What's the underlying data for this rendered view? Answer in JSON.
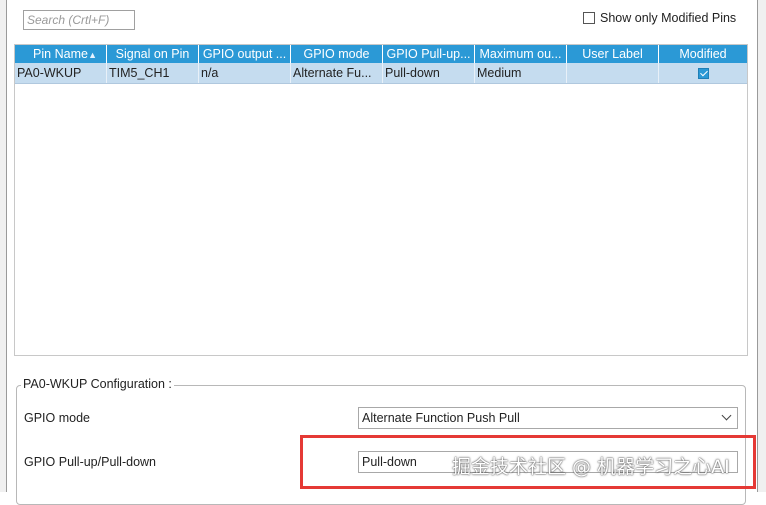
{
  "search": {
    "placeholder": "Search (Crtl+F)"
  },
  "filter": {
    "show_modified_label": "Show only Modified Pins"
  },
  "table": {
    "columns": [
      "Pin Name",
      "Signal on Pin",
      "GPIO output ...",
      "GPIO mode",
      "GPIO Pull-up...",
      "Maximum ou...",
      "User Label",
      "Modified"
    ],
    "rows": [
      {
        "pin_name": "PA0-WKUP",
        "signal": "TIM5_CH1",
        "gpio_output": "n/a",
        "gpio_mode": "Alternate Fu...",
        "pull": "Pull-down",
        "max_output": "Medium",
        "user_label": "",
        "modified": true
      }
    ]
  },
  "config": {
    "title": "PA0-WKUP Configuration :",
    "gpio_mode_label": "GPIO mode",
    "gpio_mode_value": "Alternate Function Push Pull",
    "pull_label": "GPIO Pull-up/Pull-down",
    "pull_value": "Pull-down"
  },
  "watermark": "掘金技术社区 @ 机器学习之心AI",
  "colors": {
    "header_blue": "#2b99d6",
    "selected_row": "#c5dcef",
    "highlight_red": "#e53935"
  }
}
